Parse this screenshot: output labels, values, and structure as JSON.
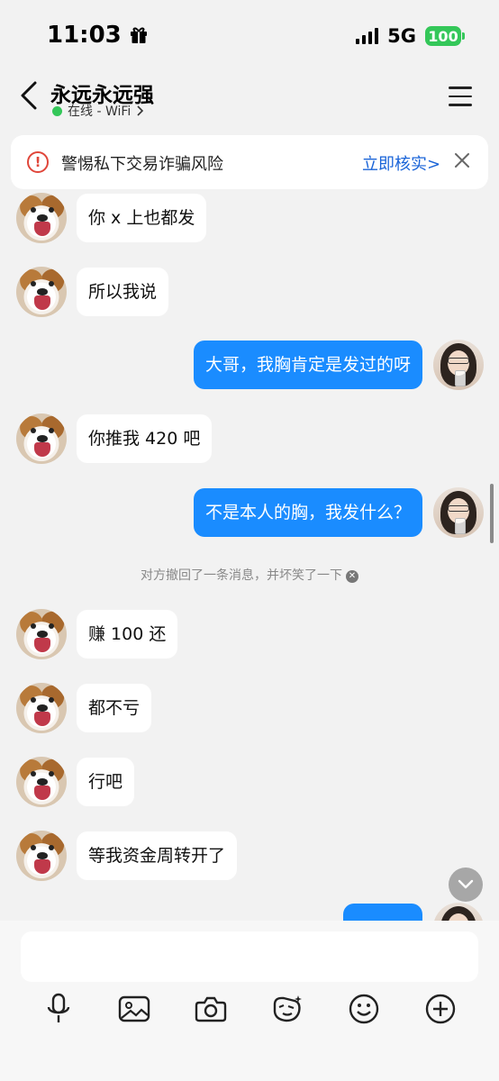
{
  "status_bar": {
    "time": "11:03",
    "network": "5G",
    "battery": "100",
    "gift_icon": "gift-icon",
    "signal_icon": "signal-icon"
  },
  "header": {
    "contact_name": "永远永远强",
    "status_text": "在线 - WiFi",
    "online_color": "#34c759"
  },
  "warning": {
    "text": "警惕私下交易诈骗风险",
    "link": "立即核实>",
    "icon": "alert-circle-icon"
  },
  "messages": [
    {
      "side": "in",
      "text": "你 x 上也都发"
    },
    {
      "side": "in",
      "text": "所以我说"
    },
    {
      "side": "out",
      "text": "大哥，我胸肯定是发过的呀"
    },
    {
      "side": "in",
      "text": "你推我 420 吧"
    },
    {
      "side": "out",
      "text": "不是本人的胸，我发什么？"
    },
    {
      "side": "in",
      "text": "赚 100 还"
    },
    {
      "side": "in",
      "text": "都不亏"
    },
    {
      "side": "in",
      "text": "行吧"
    },
    {
      "side": "in",
      "text": "等我资金周转开了"
    }
  ],
  "system_note": "对方撤回了一条消息，并坏笑了一下",
  "colors": {
    "accent_blue": "#1a8cff",
    "link_blue": "#1a64d8",
    "warning_red": "#e0463a",
    "background": "#f2f2f2"
  },
  "toolbar": [
    "microphone-icon",
    "image-icon",
    "camera-icon",
    "sticker-icon",
    "emoji-icon",
    "plus-icon"
  ]
}
